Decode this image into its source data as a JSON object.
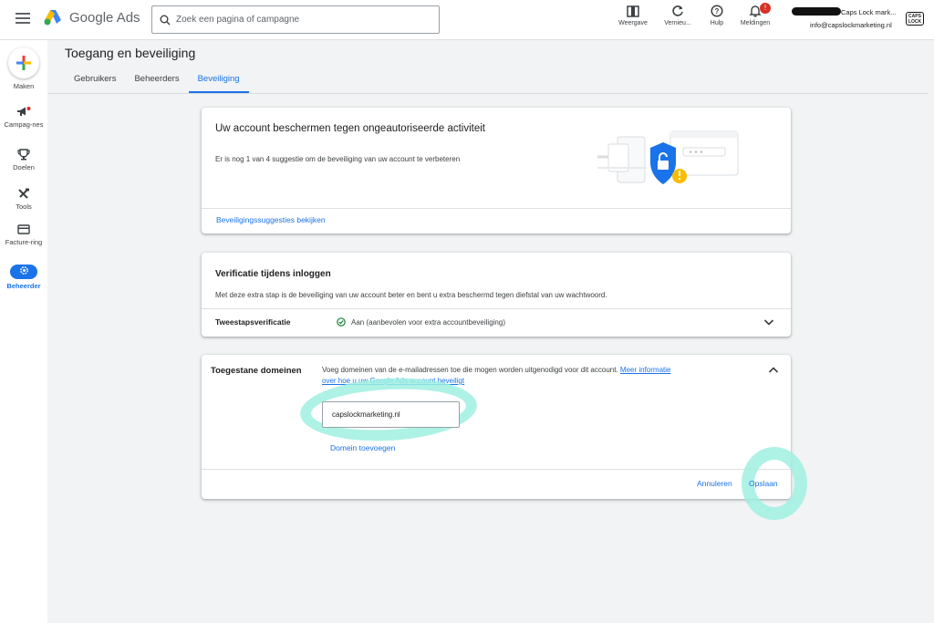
{
  "app": {
    "name": "Google Ads",
    "search_placeholder": "Zoek een pagina of campagne"
  },
  "topbar": {
    "view_label": "Weergave",
    "refresh_label": "Vernieu...",
    "help_label": "Hulp",
    "notifications_label": "Meldingen",
    "notifications_count": "!",
    "account_name": "Caps Lock mark...",
    "account_email": "info@capslockmarketing.nl",
    "account_logo_text": "CAPS LOCK"
  },
  "sidenav": {
    "create_label": "Maken",
    "items": [
      {
        "label": "Campag-nes"
      },
      {
        "label": "Doelen"
      },
      {
        "label": "Tools"
      },
      {
        "label": "Facture-ring"
      },
      {
        "label": "Beheerder"
      }
    ]
  },
  "page": {
    "title": "Toegang en beveiliging",
    "tabs": [
      {
        "label": "Gebruikers"
      },
      {
        "label": "Beheerders"
      },
      {
        "label": "Beveiliging"
      }
    ]
  },
  "protect_card": {
    "title": "Uw account beschermen tegen ongeautoriseerde activiteit",
    "text": "Er is nog 1 van 4 suggestie om de beveiliging van uw account te verbeteren",
    "link": "Beveiligingssuggesties bekijken"
  },
  "verify_card": {
    "title": "Verificatie tijdens inloggen",
    "text": "Met deze extra stap is de beveiliging van uw account beter en bent u extra beschermd tegen diefstal van uw wachtwoord.",
    "row_label": "Tweestapsverificatie",
    "row_value": "Aan (aanbevolen voor extra accountbeveiliging)"
  },
  "domains_card": {
    "title": "Toegestane domeinen",
    "description": "Voeg domeinen van de e-mailadressen toe die mogen worden uitgenodigd voor dit account.",
    "link": "Meer informatie over hoe u uw Google Ads-account beveiligt",
    "domain_value": "capslockmarketing.nl",
    "add_domain": "Domein toevoegen",
    "cancel": "Annuleren",
    "save": "Opslaan"
  },
  "colors": {
    "accent": "#1a73e8",
    "highlight": "#9ff0e0",
    "success": "#188038",
    "shield": "#1a73e8",
    "warning": "#fbbc04"
  }
}
